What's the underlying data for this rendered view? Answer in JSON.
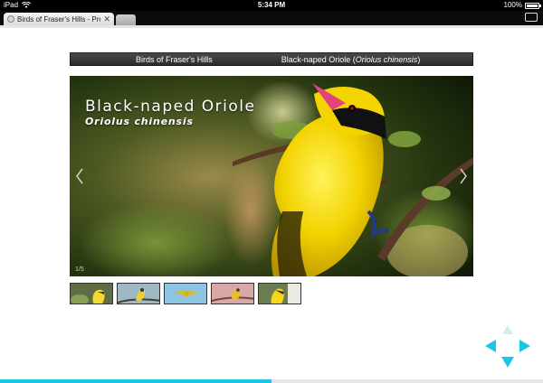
{
  "statusbar": {
    "device": "iPad",
    "time": "5:34 PM",
    "battery": "100%"
  },
  "browser": {
    "tab_title": "Birds of Fraser's Hills - Pro",
    "tab_close": "✕",
    "page_load_progress": 0.5
  },
  "nav": {
    "item1": "Birds of Fraser's Hills",
    "item2_common": "Black-naped Oriole",
    "item2_sci": "Oriolus chinensis"
  },
  "slide": {
    "title": "Black-naped Oriole",
    "subtitle": "Oriolus chinensis",
    "counter": "1/5",
    "prev_glyph": "‹",
    "next_glyph": "›"
  },
  "thumbnails": [
    {
      "name": "black-naped-oriole-thumb"
    },
    {
      "name": "bird-thumb-2"
    },
    {
      "name": "bird-thumb-3"
    },
    {
      "name": "bird-thumb-4"
    },
    {
      "name": "bird-thumb-5"
    }
  ],
  "colors": {
    "accent": "#1ac6e6",
    "navbar": "#333333",
    "oriole_yellow": "#f2d200"
  }
}
